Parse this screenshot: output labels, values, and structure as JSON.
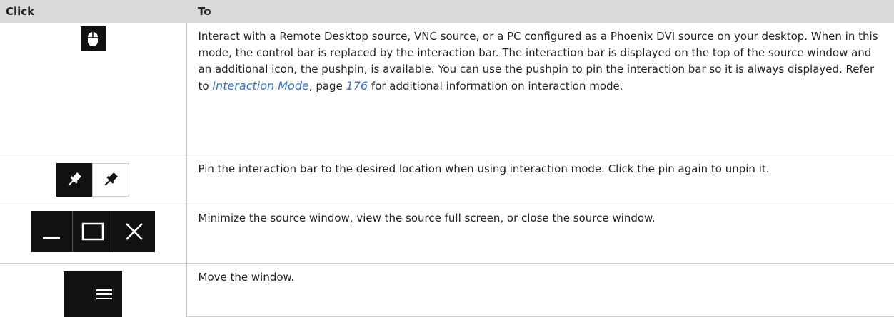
{
  "table": {
    "headers": {
      "click": "Click",
      "to": "To"
    },
    "rows": [
      {
        "icon": "mouse-icon",
        "parts": {
          "before": "Interact with a Remote Desktop source, VNC source, or a PC configured as a Phoenix DVI source on your desktop. When in this mode, the control bar is replaced by the interaction bar. The interaction bar is displayed on the top of the source window and an additional icon, the pushpin, is available. You can use the pushpin to pin the interaction bar so it is always displayed. Refer to ",
          "link": "Interaction Mode",
          "mid": ", page ",
          "page": "176",
          "after": " for additional information on interaction mode."
        }
      },
      {
        "icons": [
          "pushpin-dark-icon",
          "pushpin-light-icon"
        ],
        "text": "Pin the interaction bar to the desired location when using interaction mode. Click the pin again to unpin it."
      },
      {
        "icons": [
          "minimize-icon",
          "maximize-icon",
          "close-icon"
        ],
        "text": "Minimize the source window, view the source full screen, or close the source window."
      },
      {
        "icon": "menu-icon",
        "text": "Move the window."
      }
    ]
  },
  "colors": {
    "header_bg": "#d9d9d9",
    "link": "#3a78c3",
    "icon_bg": "#111111"
  }
}
